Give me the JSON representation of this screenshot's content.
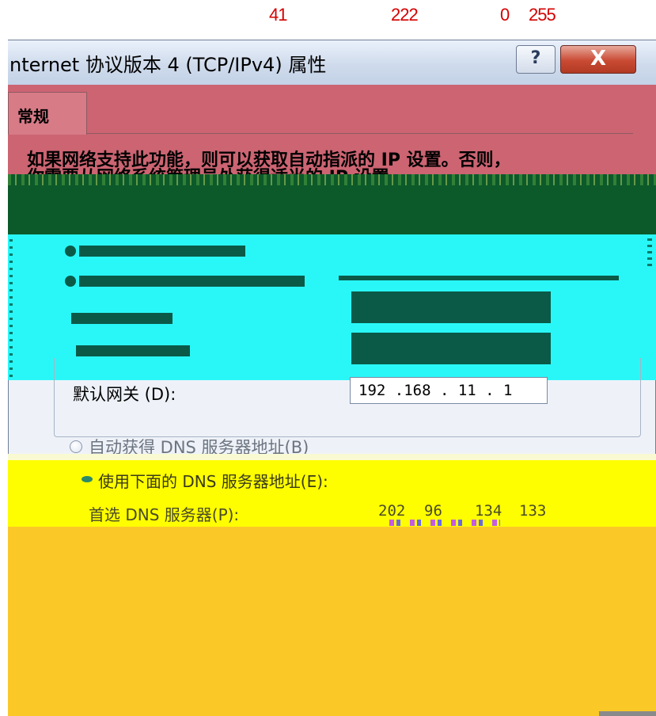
{
  "readout": {
    "r": "41",
    "g": "222",
    "b": "0",
    "a": "255"
  },
  "window": {
    "title": "nternet 协议版本 4 (TCP/IPv4) 属性",
    "help_label": "?",
    "close_label": "X"
  },
  "tabs": [
    {
      "label": "常规"
    }
  ],
  "description": {
    "line1": "如果网络支持此功能，则可以获取自动指派的 IP 设置。否则，",
    "line2": "你需要从网络系统管理员处获得适当的 IP 设置。"
  },
  "ip_section": {
    "gateway_label": "默认网关 (D):",
    "gateway_value": "192 .168 . 11  . 1"
  },
  "dns_section": {
    "auto_label": "自动获得 DNS 服务器地址(B)",
    "manual_label": "使用下面的 DNS 服务器地址(E):",
    "preferred_label": "首选 DNS 服务器(P):",
    "preferred_value": [
      "202",
      "96",
      "134",
      "133"
    ]
  },
  "colors": {
    "pink": "#cc6472",
    "dark_green": "#0c5a2a",
    "cyan": "#29f7f7",
    "yellow": "#fefe00",
    "orange": "#fbc927",
    "readout_red": "#d40000"
  }
}
